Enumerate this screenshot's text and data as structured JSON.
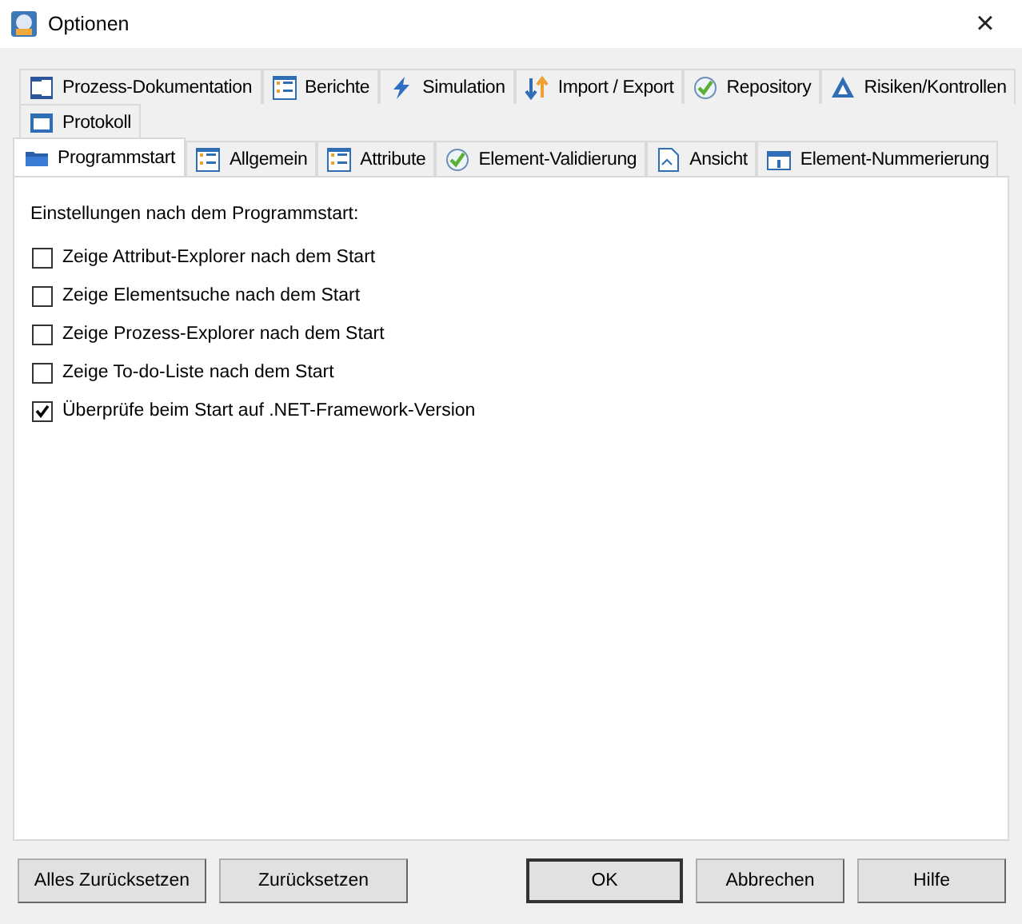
{
  "window": {
    "title": "Optionen",
    "close": "×"
  },
  "tab_rows": [
    [
      {
        "label": "Prozess-Dokumentation",
        "kind": "word",
        "selected": false
      },
      {
        "label": "Berichte",
        "kind": "list",
        "selected": false
      },
      {
        "label": "Simulation",
        "kind": "bolt",
        "selected": false
      },
      {
        "label": "Import / Export",
        "kind": "arrows",
        "selected": false
      },
      {
        "label": "Repository",
        "kind": "check",
        "selected": false
      },
      {
        "label": "Risiken/Kontrollen",
        "kind": "triangle",
        "selected": false
      }
    ],
    [
      {
        "label": "Protokoll",
        "kind": "window",
        "selected": false
      }
    ],
    [
      {
        "label": "Programmstart",
        "kind": "folder",
        "selected": true
      },
      {
        "label": "Allgemein",
        "kind": "list",
        "selected": false
      },
      {
        "label": "Attribute",
        "kind": "list",
        "selected": false
      },
      {
        "label": "Element-Validierung",
        "kind": "check",
        "selected": false
      },
      {
        "label": "Ansicht",
        "kind": "doc",
        "selected": false
      },
      {
        "label": "Element-Nummerierung",
        "kind": "number",
        "selected": false
      }
    ]
  ],
  "panel": {
    "heading": "Einstellungen nach dem Programmstart:",
    "options": [
      {
        "label": "Zeige Attribut-Explorer nach dem Start",
        "checked": false
      },
      {
        "label": "Zeige Elementsuche nach dem Start",
        "checked": false
      },
      {
        "label": "Zeige Prozess-Explorer nach dem Start",
        "checked": false
      },
      {
        "label": "Zeige To-do-Liste nach dem Start",
        "checked": false
      },
      {
        "label": "Überprüfe beim Start auf .NET-Framework-Version",
        "checked": true
      }
    ]
  },
  "buttons": [
    {
      "label": "Alles Zurücksetzen",
      "kind": "left",
      "default": false
    },
    {
      "label": "Zurücksetzen",
      "kind": "left",
      "default": false
    },
    {
      "label": "OK",
      "kind": "right",
      "default": true
    },
    {
      "label": "Abbrechen",
      "kind": "right",
      "default": false
    },
    {
      "label": "Hilfe",
      "kind": "right",
      "default": false
    }
  ]
}
